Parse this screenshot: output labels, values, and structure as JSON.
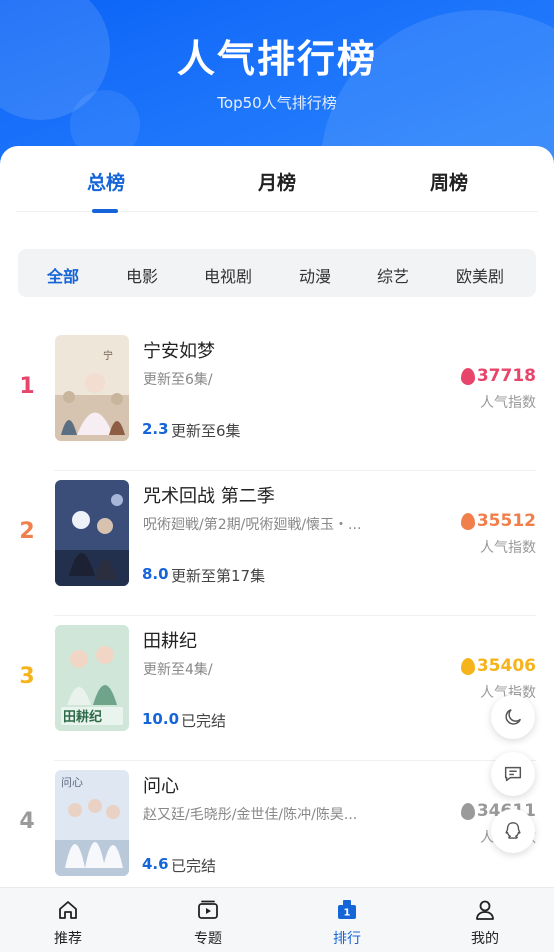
{
  "header": {
    "title": "人气排行榜",
    "subtitle": "Top50人气排行榜"
  },
  "tabs": [
    {
      "label": "总榜",
      "active": true
    },
    {
      "label": "月榜",
      "active": false
    },
    {
      "label": "周榜",
      "active": false
    }
  ],
  "categories": [
    {
      "label": "全部",
      "active": true
    },
    {
      "label": "电影",
      "active": false
    },
    {
      "label": "电视剧",
      "active": false
    },
    {
      "label": "动漫",
      "active": false
    },
    {
      "label": "综艺",
      "active": false
    },
    {
      "label": "欧美剧",
      "active": false
    }
  ],
  "items": [
    {
      "rank": "1",
      "name": "宁安如梦",
      "desc": "更新至6集/",
      "score": "2.3",
      "status": "更新至6集",
      "heat": "37718",
      "heat_label": "人气指数",
      "rank_color": "#e8456b",
      "heat_color": "#e8456b"
    },
    {
      "rank": "2",
      "name": "咒术回战 第二季",
      "desc": "呪術廻戦/第2期/呪術廻戦/懐玉・...",
      "score": "8.0",
      "status": "更新至第17集",
      "heat": "35512",
      "heat_label": "人气指数",
      "rank_color": "#f07f4c",
      "heat_color": "#f07f4c"
    },
    {
      "rank": "3",
      "name": "田耕纪",
      "desc": "更新至4集/",
      "score": "10.0",
      "status": "已完结",
      "heat": "35406",
      "heat_label": "人气指数",
      "rank_color": "#f5b41b",
      "heat_color": "#f5b41b"
    },
    {
      "rank": "4",
      "name": "问心",
      "desc": "赵又廷/毛晓彤/金世佳/陈冲/陈昊...",
      "score": "4.6",
      "status": "已完结",
      "heat": "34611",
      "heat_label": "人气指数",
      "rank_color": "#9a9a9a",
      "heat_color": "#9a9a9a"
    }
  ],
  "bottom_nav": [
    {
      "label": "推荐",
      "icon": "home-icon",
      "active": false
    },
    {
      "label": "专题",
      "icon": "topic-icon",
      "active": false
    },
    {
      "label": "排行",
      "icon": "rank-icon",
      "active": true
    },
    {
      "label": "我的",
      "icon": "user-icon",
      "active": false
    }
  ],
  "floating": [
    "moon-icon",
    "chat-icon",
    "qq-icon"
  ],
  "colors": {
    "accent": "#1565d8",
    "header": "#1a6ff8"
  }
}
